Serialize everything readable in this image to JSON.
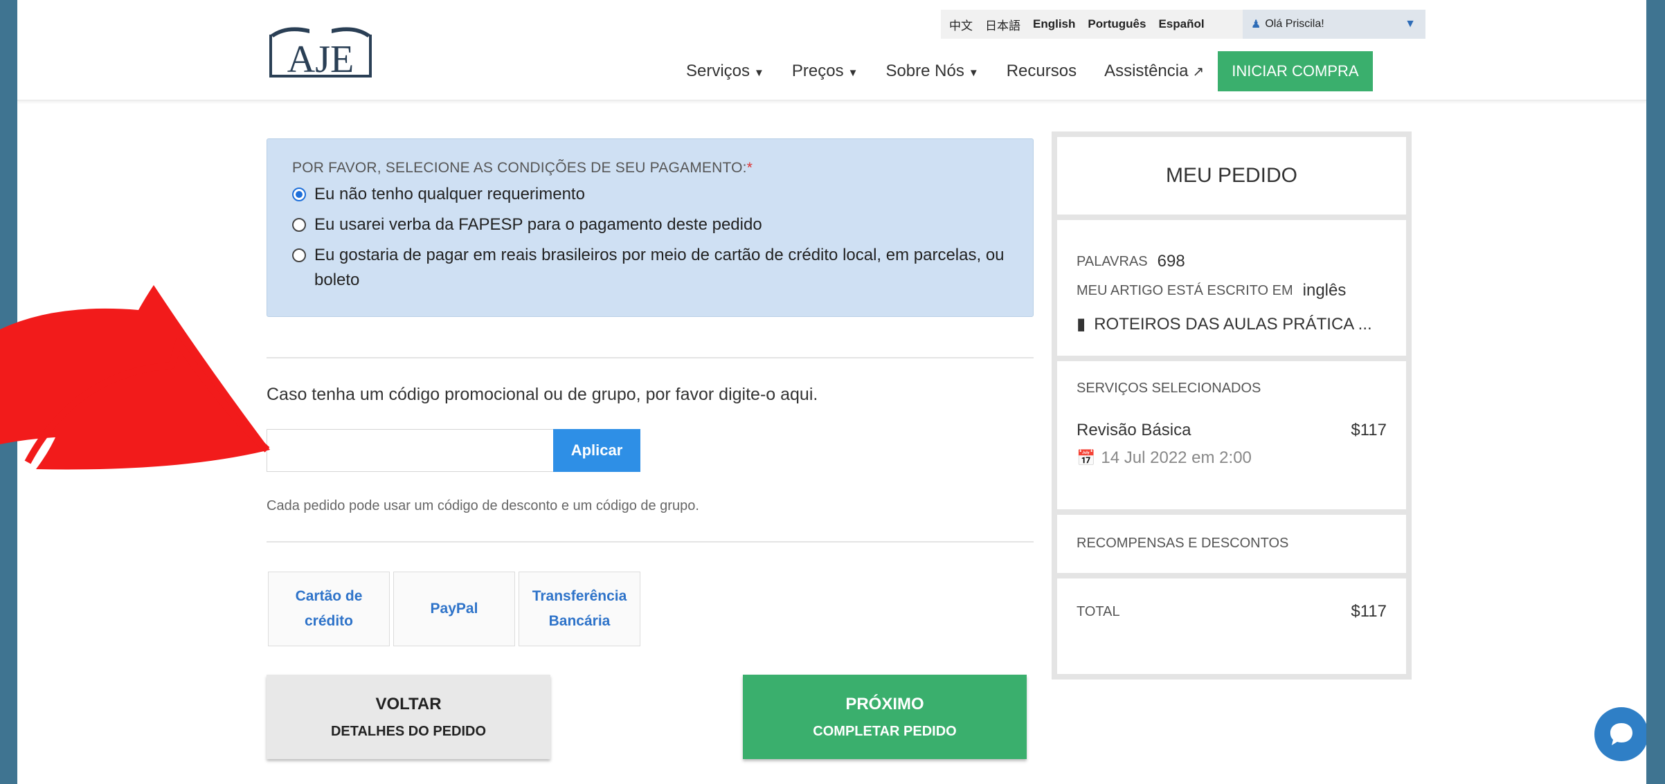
{
  "header": {
    "logo_text": "AJE",
    "languages": [
      "中文",
      "日本語",
      "English",
      "Português",
      "Español"
    ],
    "user_greeting": "Olá Priscila!",
    "nav": {
      "servicos": "Serviços",
      "precos": "Preços",
      "sobre": "Sobre Nós",
      "recursos": "Recursos",
      "assistencia": "Assistência",
      "cta": "INICIAR COMPRA"
    }
  },
  "payment_conditions": {
    "title": "POR FAVOR, SELECIONE AS CONDIÇÕES DE SEU PAGAMENTO:",
    "required_mark": "*",
    "options": [
      "Eu não tenho qualquer requerimento",
      "Eu usarei verba da FAPESP para o pagamento deste pedido",
      "Eu gostaria de pagar em reais brasileiros por meio de cartão de crédito local, em parcelas, ou boleto"
    ],
    "selected_index": 0
  },
  "promo": {
    "label": "Caso tenha um código promocional ou de grupo, por favor digite-o aqui.",
    "input_value": "",
    "apply_label": "Aplicar",
    "note": "Cada pedido pode usar um código de desconto e um código de grupo."
  },
  "payment_methods": [
    {
      "line1": "Cartão de",
      "line2": "crédito"
    },
    {
      "line1": "PayPal",
      "line2": ""
    },
    {
      "line1": "Transferência",
      "line2": "Bancária"
    }
  ],
  "buttons": {
    "back_title": "VOLTAR",
    "back_sub": "DETALHES DO PEDIDO",
    "next_title": "PRÓXIMO",
    "next_sub": "COMPLETAR PEDIDO"
  },
  "order": {
    "title": "MEU PEDIDO",
    "words_label": "PALAVRAS",
    "words_value": "698",
    "language_label": "MEU ARTIGO ESTÁ ESCRITO EM",
    "language_value": "inglês",
    "file_name": "ROTEIROS DAS AULAS PRÁTICA ...",
    "services_label": "SERVIÇOS SELECIONADOS",
    "service_name": "Revisão Básica",
    "service_price": "$117",
    "service_date": "14 Jul 2022 em 2:00",
    "rewards_label": "RECOMPENSAS E DESCONTOS",
    "total_label": "TOTAL",
    "total_value": "$117"
  },
  "colors": {
    "frame": "#3f7491",
    "accent_green": "#3aaf6d",
    "accent_blue": "#2e8fe6",
    "annotation_arrow": "#f21b1b"
  }
}
